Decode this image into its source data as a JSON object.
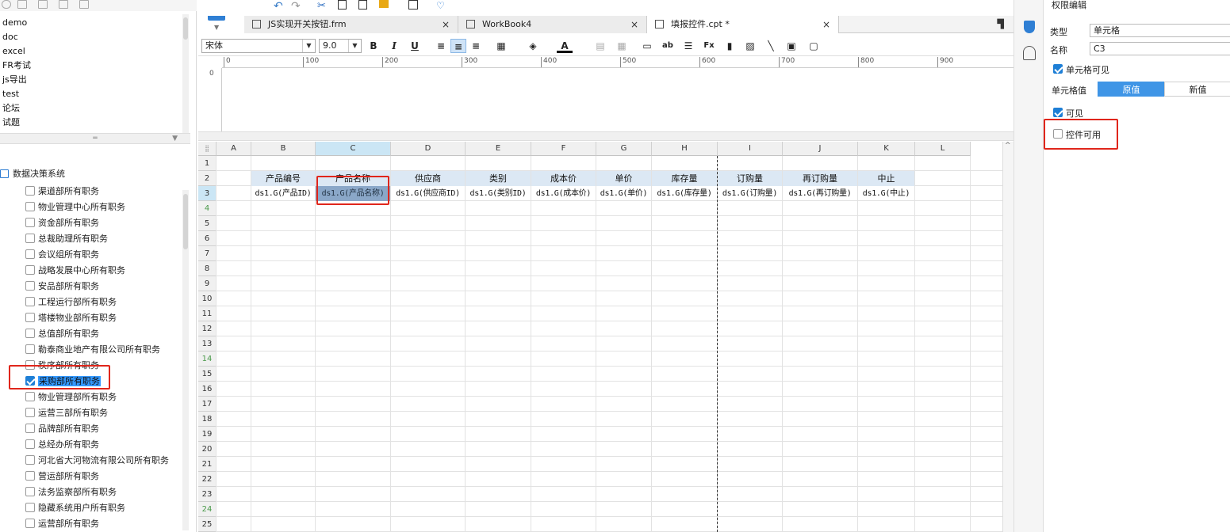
{
  "left_panel": {
    "files": [
      "demo",
      "doc",
      "excel",
      "FR考试",
      "js导出",
      "test",
      "论坛",
      "试题"
    ],
    "tree_root": "数据决策系统",
    "tree_items": [
      {
        "label": "渠道部所有职务",
        "checked": false
      },
      {
        "label": "物业管理中心所有职务",
        "checked": false
      },
      {
        "label": "资金部所有职务",
        "checked": false
      },
      {
        "label": "总裁助理所有职务",
        "checked": false
      },
      {
        "label": "会议组所有职务",
        "checked": false
      },
      {
        "label": "战略发展中心所有职务",
        "checked": false
      },
      {
        "label": "安品部所有职务",
        "checked": false
      },
      {
        "label": "工程运行部所有职务",
        "checked": false
      },
      {
        "label": "塔楼物业部所有职务",
        "checked": false
      },
      {
        "label": "总值部所有职务",
        "checked": false
      },
      {
        "label": "勒泰商业地产有限公司所有职务",
        "checked": false
      },
      {
        "label": "秩序部所有职务",
        "checked": false
      },
      {
        "label": "采购部所有职务",
        "checked": true
      },
      {
        "label": "物业管理部所有职务",
        "checked": false
      },
      {
        "label": "运营三部所有职务",
        "checked": false
      },
      {
        "label": "品牌部所有职务",
        "checked": false
      },
      {
        "label": "总经办所有职务",
        "checked": false
      },
      {
        "label": "河北省大河物流有限公司所有职务",
        "checked": false
      },
      {
        "label": "营运部所有职务",
        "checked": false
      },
      {
        "label": "法务监察部所有职务",
        "checked": false
      },
      {
        "label": "隐藏系统用户所有职务",
        "checked": false
      },
      {
        "label": "运营部所有职务",
        "checked": false
      }
    ]
  },
  "tabs": [
    {
      "label": "JS实现开关按钮.frm",
      "close": "×"
    },
    {
      "label": "WorkBook4",
      "close": "×"
    },
    {
      "label": "填报控件.cpt *",
      "close": "×"
    }
  ],
  "format_bar": {
    "font": "宋体",
    "size": "9.0",
    "bold": "B",
    "italic": "I",
    "underline": "U"
  },
  "ruler": [
    "0",
    "100",
    "200",
    "300",
    "400",
    "500",
    "600",
    "700",
    "800",
    "900"
  ],
  "vruler": "0",
  "grid": {
    "columns": [
      "A",
      "B",
      "C",
      "D",
      "E",
      "F",
      "G",
      "H",
      "I",
      "J",
      "K",
      "L"
    ],
    "rows": [
      "1",
      "2",
      "3",
      "4",
      "5",
      "6",
      "7",
      "8",
      "9",
      "10",
      "11",
      "12",
      "13",
      "14",
      "15",
      "16",
      "17",
      "18",
      "19",
      "20",
      "21",
      "22",
      "23",
      "24",
      "25"
    ],
    "header_row": [
      "产品编号",
      "产品名称",
      "供应商",
      "类别",
      "成本价",
      "单价",
      "库存量",
      "订购量",
      "再订购量",
      "中止"
    ],
    "data_row": [
      "ds1.G(产品ID)",
      "ds1.G(产品名称)",
      "ds1.G(供应商ID)",
      "ds1.G(类别ID)",
      "ds1.G(成本价)",
      "ds1.G(单价)",
      "ds1.G(库存量)",
      "ds1.G(订购量)",
      "ds1.G(再订购量)",
      "ds1.G(中止)"
    ]
  },
  "right_panel": {
    "title": "权限编辑",
    "type_label": "类型",
    "type_value": "单元格",
    "name_label": "名称",
    "name_value": "C3",
    "cell_visible": "单元格可见",
    "cell_value_label": "单元格值",
    "seg_original": "原值",
    "seg_new": "新值",
    "visible": "可见",
    "widget_enabled": "控件可用"
  }
}
